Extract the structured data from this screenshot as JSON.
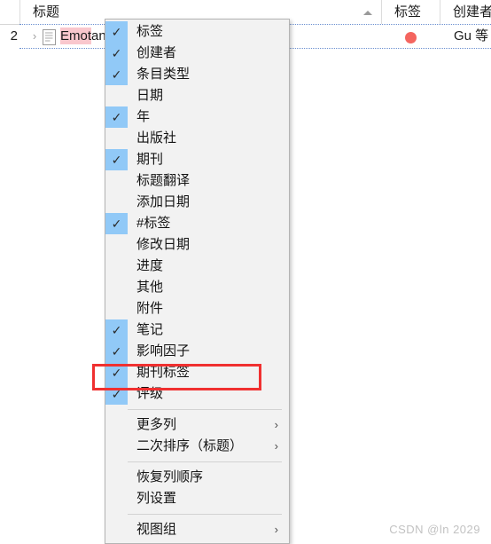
{
  "table": {
    "headers": [
      {
        "label": "标题",
        "sorted": true,
        "sort_direction": "ascending"
      },
      {
        "label": "标签",
        "sorted": false,
        "sort_direction": ""
      },
      {
        "label": "创建者",
        "sorted": false,
        "sort_direction": ""
      }
    ],
    "row": {
      "index": "2",
      "expand_glyph": "›",
      "title_highlight": "Emot",
      "title_rest": "anjin on colle...",
      "tag_color": "#f4655f",
      "creator": "Gu 等"
    }
  },
  "context_menu": {
    "items": [
      {
        "label": "标签",
        "checked": true,
        "submenu": false,
        "sep_after": false
      },
      {
        "label": "创建者",
        "checked": true,
        "submenu": false,
        "sep_after": false
      },
      {
        "label": "条目类型",
        "checked": true,
        "submenu": false,
        "sep_after": false
      },
      {
        "label": "日期",
        "checked": false,
        "submenu": false,
        "sep_after": false
      },
      {
        "label": "年",
        "checked": true,
        "submenu": false,
        "sep_after": false
      },
      {
        "label": "出版社",
        "checked": false,
        "submenu": false,
        "sep_after": false
      },
      {
        "label": "期刊",
        "checked": true,
        "submenu": false,
        "sep_after": false
      },
      {
        "label": "标题翻译",
        "checked": false,
        "submenu": false,
        "sep_after": false
      },
      {
        "label": "添加日期",
        "checked": false,
        "submenu": false,
        "sep_after": false
      },
      {
        "label": "#标签",
        "checked": true,
        "submenu": false,
        "sep_after": false
      },
      {
        "label": "修改日期",
        "checked": false,
        "submenu": false,
        "sep_after": false
      },
      {
        "label": "进度",
        "checked": false,
        "submenu": false,
        "sep_after": false
      },
      {
        "label": "其他",
        "checked": false,
        "submenu": false,
        "sep_after": false
      },
      {
        "label": "附件",
        "checked": false,
        "submenu": false,
        "sep_after": false
      },
      {
        "label": "笔记",
        "checked": true,
        "submenu": false,
        "sep_after": false
      },
      {
        "label": "影响因子",
        "checked": true,
        "submenu": false,
        "sep_after": false
      },
      {
        "label": "期刊标签",
        "checked": true,
        "submenu": false,
        "sep_after": false,
        "highlighted": true
      },
      {
        "label": "评级",
        "checked": true,
        "submenu": false,
        "sep_after": true
      },
      {
        "label": "更多列",
        "checked": false,
        "submenu": true,
        "sep_after": false
      },
      {
        "label": "二次排序（标题）",
        "checked": false,
        "submenu": true,
        "sep_after": true
      },
      {
        "label": "恢复列顺序",
        "checked": false,
        "submenu": false,
        "sep_after": false
      },
      {
        "label": "列设置",
        "checked": false,
        "submenu": false,
        "sep_after": true
      },
      {
        "label": "视图组",
        "checked": false,
        "submenu": true,
        "sep_after": false
      }
    ],
    "check_glyph": "✓",
    "submenu_glyph": "›",
    "check_highlight_color": "#91c9f7"
  },
  "annotation": {
    "highlight_color": "#f03030"
  },
  "watermark": {
    "text": "CSDN @ln 2029"
  }
}
